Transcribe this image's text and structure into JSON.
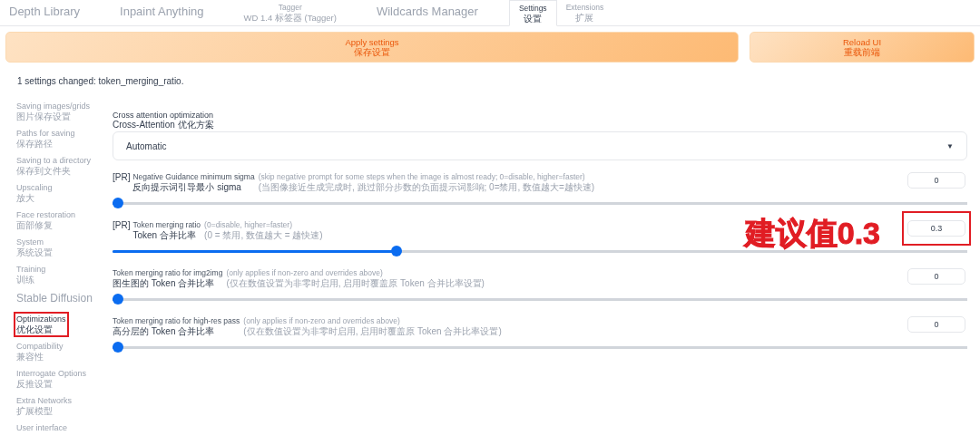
{
  "tabs": [
    {
      "lines": [
        "Depth Library"
      ],
      "selected": false
    },
    {
      "lines": [
        "Inpaint Anything"
      ],
      "selected": false
    },
    {
      "lines": [
        "Tagger",
        "WD 1.4 标签器 (Tagger)"
      ],
      "selected": false
    },
    {
      "lines": [
        "Wildcards Manager"
      ],
      "selected": false
    },
    {
      "lines": [
        "Settings",
        "设置"
      ],
      "selected": true
    },
    {
      "lines": [
        "Extensions",
        "扩展"
      ],
      "selected": false
    }
  ],
  "buttons": [
    {
      "label": "Apply settings",
      "label_zh": "保存设置",
      "kind": "wide"
    },
    {
      "label": "Reload UI",
      "label_zh": "重载前端",
      "kind": "narrow"
    }
  ],
  "status": "1 settings changed: token_merging_ratio.",
  "sidebar": [
    {
      "kind": "item",
      "label": "Saving images/grids",
      "label_zh": "图片保存设置",
      "selected": false,
      "highlighted": false
    },
    {
      "kind": "item",
      "label": "Paths for saving",
      "label_zh": "保存路径",
      "selected": false,
      "highlighted": false
    },
    {
      "kind": "item",
      "label": "Saving to a directory",
      "label_zh": "保存到文件夹",
      "selected": false,
      "highlighted": false
    },
    {
      "kind": "item",
      "label": "Upscaling",
      "label_zh": "放大",
      "selected": false,
      "highlighted": false
    },
    {
      "kind": "item",
      "label": "Face restoration",
      "label_zh": "面部修复",
      "selected": false,
      "highlighted": false
    },
    {
      "kind": "item",
      "label": "System",
      "label_zh": "系统设置",
      "selected": false,
      "highlighted": false
    },
    {
      "kind": "item",
      "label": "Training",
      "label_zh": "训练",
      "selected": false,
      "highlighted": false
    },
    {
      "kind": "heading",
      "label": "Stable Diffusion"
    },
    {
      "kind": "item",
      "label": "Optimizations",
      "label_zh": "优化设置",
      "selected": true,
      "highlighted": true
    },
    {
      "kind": "item",
      "label": "Compatibility",
      "label_zh": "兼容性",
      "selected": false,
      "highlighted": false
    },
    {
      "kind": "item",
      "label": "Interrogate Options",
      "label_zh": "反推设置",
      "selected": false,
      "highlighted": false
    },
    {
      "kind": "item",
      "label": "Extra Networks",
      "label_zh": "扩展模型",
      "selected": false,
      "highlighted": false
    },
    {
      "kind": "item",
      "label": "User interface",
      "selected": false,
      "highlighted": false
    }
  ],
  "settings": [
    {
      "kind": "dropdown",
      "label": "Cross attention optimization",
      "label_zh": "Cross-Attention 优化方案",
      "value": "Automatic",
      "caret": "▼"
    },
    {
      "kind": "slider",
      "pr": "[PR]",
      "label": "Negative Guidance minimum sigma",
      "label_zh": "反向提示词引导最小 sigma",
      "note": "(skip negative prompt for some steps when the image is almost ready; 0=disable, higher=faster)",
      "note_zh": "(当图像接近生成完成时, 跳过部分步数的负面提示词影响; 0=禁用, 数值越大=越快速)",
      "value": "0",
      "level": 0,
      "highlighted": false
    },
    {
      "kind": "slider",
      "pr": "[PR]",
      "label": "Token merging ratio",
      "label_zh": "Token 合并比率",
      "note": "(0=disable, higher=faster)",
      "note_zh": "(0 = 禁用, 数值越大 = 越快速)",
      "value": "0.3",
      "level": 0.33,
      "highlighted": true,
      "annotation": "建议值0.3"
    },
    {
      "kind": "slider",
      "label": "Token merging ratio for img2img",
      "label_zh": "图生图的 Token 合并比率",
      "note": "(only applies if non-zero and overrides above)",
      "note_zh": "(仅在数值设置为非零时启用, 启用时覆盖原 Token 合并比率设置)",
      "value": "0",
      "level": 0,
      "highlighted": false
    },
    {
      "kind": "slider",
      "label": "Token merging ratio for high-res pass",
      "label_zh": "高分层的 Token 合并比率",
      "note": "(only applies if non-zero and overrides above)",
      "note_zh": "(仅在数值设置为非零时启用, 启用时覆盖原 Token 合并比率设置)",
      "value": "0",
      "level": 0,
      "highlighted": false
    }
  ]
}
